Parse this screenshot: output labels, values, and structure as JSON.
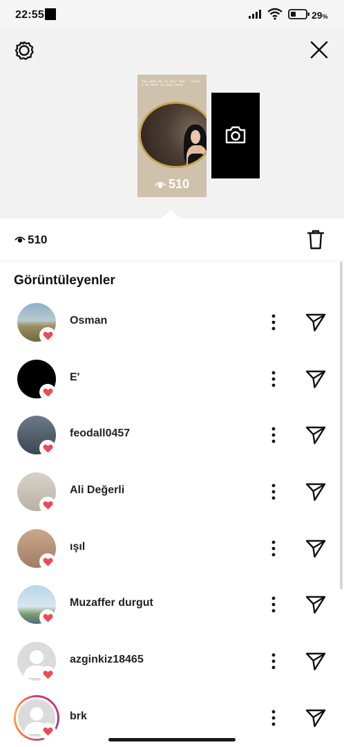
{
  "status_bar": {
    "time": "22:55",
    "battery_percent": "29",
    "battery_unit": "%"
  },
  "header": {
    "settings_icon": "gear-icon",
    "close_icon": "close-icon",
    "story_thumbnail": {
      "caption_text": "You want me in your bed. 'cause I've been in your head",
      "view_count": "510"
    },
    "add_story_icon": "camera-icon"
  },
  "views": {
    "count": "510",
    "delete_icon": "trash-icon"
  },
  "viewers": {
    "title": "Görüntüleyenler",
    "items": [
      {
        "username": "Osman",
        "liked": true
      },
      {
        "username": "E'",
        "liked": true
      },
      {
        "username": "feodall0457",
        "liked": true
      },
      {
        "username": "Ali Değerli",
        "liked": true
      },
      {
        "username": "ışıl",
        "liked": true
      },
      {
        "username": "Muzaffer durgut",
        "liked": true
      },
      {
        "username": "azginkiz18465",
        "liked": true
      },
      {
        "username": "brk",
        "liked": true
      }
    ]
  },
  "colors": {
    "like_heart": "#ed4956",
    "header_bg": "#f2f2f2",
    "text": "#111111"
  }
}
